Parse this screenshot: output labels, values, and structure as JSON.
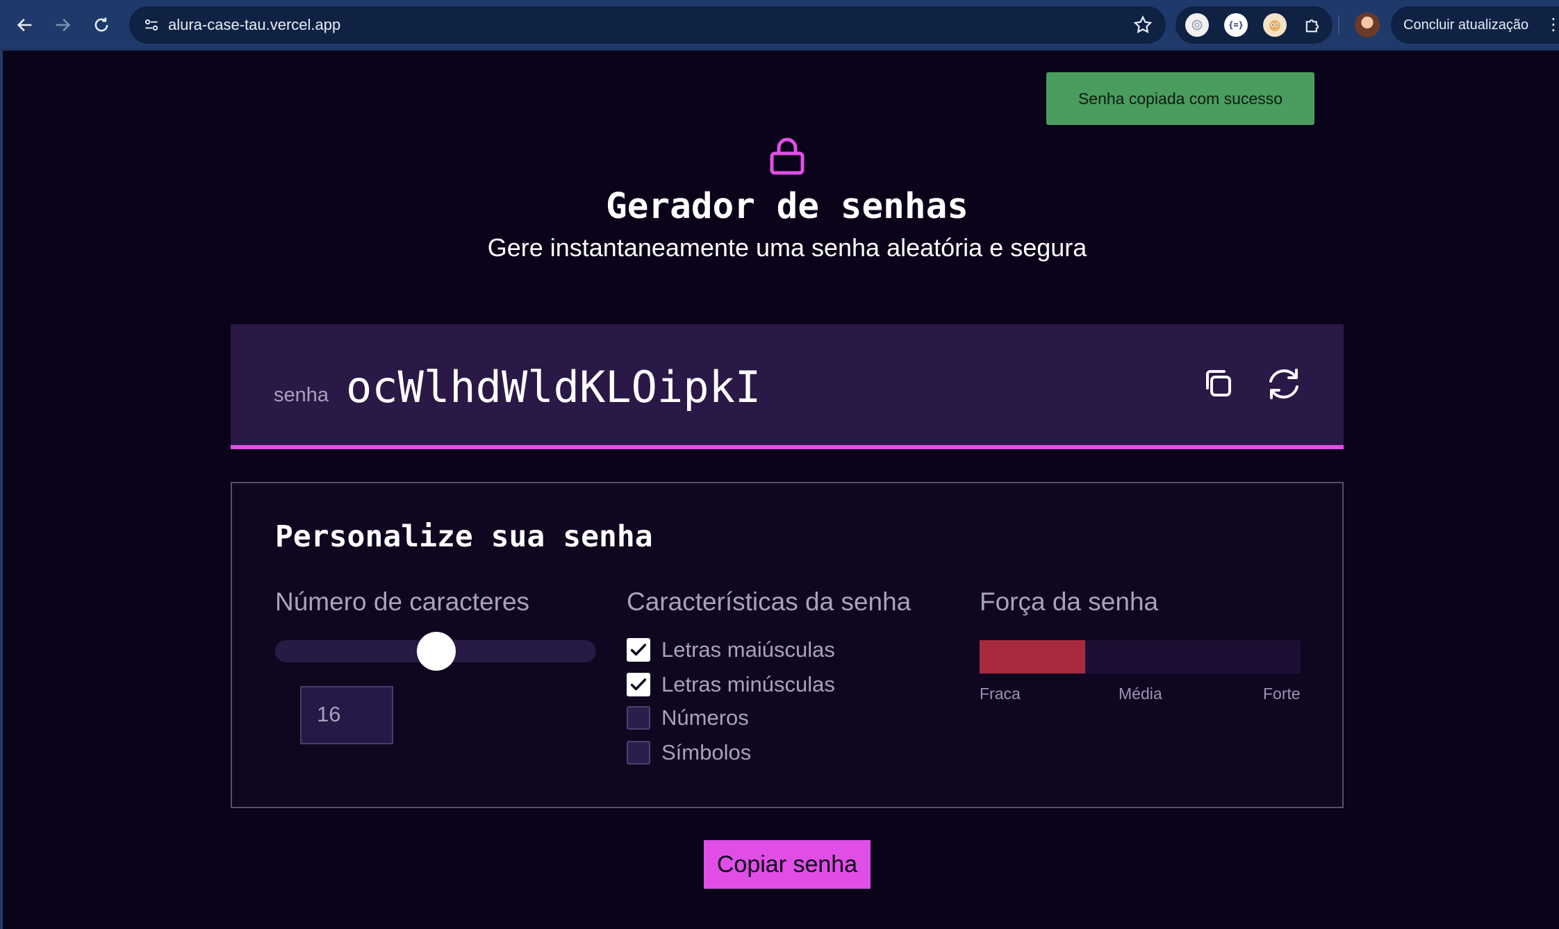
{
  "browser": {
    "url": "alura-case-tau.vercel.app",
    "update_label": "Concluir atualização",
    "extensions": [
      "openai-icon",
      "json-icon",
      "mascot-icon",
      "puzzle-icon"
    ]
  },
  "toast": {
    "message": "Senha copiada com sucesso",
    "color": "#4a9c5f"
  },
  "header": {
    "icon": "lock-icon",
    "title": "Gerador de senhas",
    "subtitle": "Gere instantaneamente uma senha aleatória e segura"
  },
  "password": {
    "label": "senha",
    "value": "ocWlhdWldKLOipkI",
    "actions": [
      "copy-icon",
      "refresh-icon"
    ]
  },
  "settings": {
    "title": "Personalize sua senha",
    "length": {
      "heading": "Número de caracteres",
      "value": "16",
      "slider_fraction": 0.5
    },
    "characteristics": {
      "heading": "Características da senha",
      "options": [
        {
          "label": "Letras maiúsculas",
          "checked": true
        },
        {
          "label": "Letras minúsculas",
          "checked": true
        },
        {
          "label": "Números",
          "checked": false
        },
        {
          "label": "Símbolos",
          "checked": false
        }
      ]
    },
    "strength": {
      "heading": "Força da senha",
      "level_fraction": 0.33,
      "color": "#a82a3e",
      "labels": [
        "Fraca",
        "Média",
        "Forte"
      ]
    }
  },
  "copy_button": {
    "label": "Copiar senha",
    "color": "#e04ee6"
  },
  "colors": {
    "accent": "#e14ee7",
    "background": "#0b0319",
    "panel": "#2a1946"
  }
}
